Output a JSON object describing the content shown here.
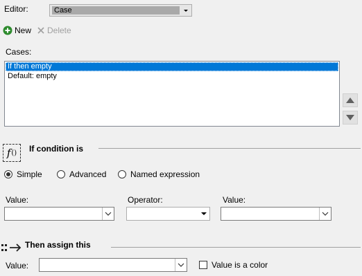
{
  "editor": {
    "label": "Editor:",
    "value": "Case"
  },
  "toolbar": {
    "new_label": "New",
    "delete_label": "Delete"
  },
  "cases": {
    "label": "Cases:",
    "items": [
      "If  then empty",
      "Default: empty"
    ],
    "selected_index": 0
  },
  "condition": {
    "title": "If condition is",
    "fx_symbol": "f",
    "fx_parens": "()",
    "radios": [
      {
        "label": "Simple",
        "checked": true
      },
      {
        "label": "Advanced",
        "checked": false
      },
      {
        "label": "Named expression",
        "checked": false
      }
    ],
    "value_left_label": "Value:",
    "operator_label": "Operator:",
    "value_right_label": "Value:",
    "value_left": "",
    "operator": "",
    "value_right": ""
  },
  "assign": {
    "title": "Then assign this",
    "value_label": "Value:",
    "value": "",
    "color_checkbox_label": "Value is a color",
    "color_checked": false
  },
  "icons": {
    "new": "plus-circle-icon",
    "delete": "x-icon",
    "move_up": "triangle-up-icon",
    "move_down": "triangle-down-icon",
    "assign": "arrow-right-icon"
  },
  "colors": {
    "new_green": "#2e8b2e",
    "selection": "#0078d7"
  }
}
